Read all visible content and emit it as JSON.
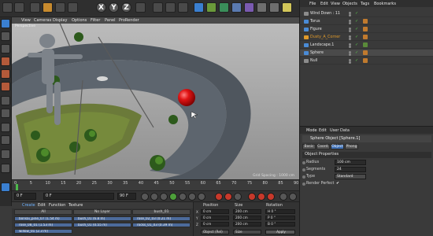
{
  "viewport": {
    "menu": [
      "View",
      "Cameras",
      "Display",
      "Options",
      "Filter",
      "Panel",
      "ProRender"
    ],
    "camera_label": "Perspective",
    "grid_spacing": "Grid Spacing : 1000 cm"
  },
  "toolbar": {
    "axis_buttons": [
      "X",
      "Y",
      "Z"
    ]
  },
  "objects": {
    "menu": [
      "File",
      "Edit",
      "View",
      "Objects",
      "Tags",
      "Bookmarks"
    ],
    "rows": [
      {
        "name": "Wind Down : 11",
        "color": "#8c8c8c"
      },
      {
        "name": "Torus",
        "color": "#4a8bd6"
      },
      {
        "name": "Figure",
        "color": "#4a8bd6"
      },
      {
        "name": "Dusty_A_Corner",
        "color": "#e09a2a"
      },
      {
        "name": "Landscape.1",
        "color": "#4a8bd6"
      },
      {
        "name": "Sphere",
        "color": "#4a8bd6"
      },
      {
        "name": "Null",
        "color": "#8c8c8c"
      }
    ]
  },
  "attributes": {
    "menu": [
      "Mode",
      "Edit",
      "User Data"
    ],
    "header": "Sphere Object [Sphere.1]",
    "tabs": [
      "Basic",
      "Coord.",
      "Object",
      "Phong"
    ],
    "active_tab": "Object",
    "section": "Object Properties",
    "fields": [
      {
        "label": "Radius",
        "value": "100 cm"
      },
      {
        "label": "Segments",
        "value": "24"
      },
      {
        "label": "Type",
        "value": "Standard"
      },
      {
        "label": "Render Perfect",
        "value": "✔"
      }
    ]
  },
  "timeline": {
    "ticks": [
      "0",
      "5",
      "10",
      "15",
      "20",
      "25",
      "30",
      "35",
      "40",
      "45",
      "50",
      "55",
      "60",
      "65",
      "70",
      "75",
      "80",
      "85",
      "90"
    ],
    "current_frame": "0 F",
    "start_frame": "0 F",
    "end_frame": "90 F",
    "max_frame": "90 F"
  },
  "materials": {
    "menu": [
      "Create",
      "Edit",
      "Function",
      "Texture"
    ],
    "active_menu": "Create",
    "columns": [
      "All",
      "No Layer",
      "bush_01"
    ],
    "items": [
      [
        "bonsai_pine_07 (1.54 m)",
        "bush_01 (6.8 m)",
        "rose_02_03 (0.21 m)"
      ],
      [
        "rose_08_01 (1.53 m)",
        "bush_01 (0.55 m)",
        "rocks_01_03 (0.39 m)"
      ],
      [
        "willow_01 (2.3 m)",
        "",
        ""
      ]
    ]
  },
  "coordinates": {
    "headers": [
      "Position",
      "Size",
      "Rotation"
    ],
    "rows": [
      {
        "axis": "X",
        "pos": "0 cm",
        "size": "200 cm",
        "rot": "H  0 °"
      },
      {
        "axis": "Y",
        "pos": "0 cm",
        "size": "200 cm",
        "rot": "P  0 °"
      },
      {
        "axis": "Z",
        "pos": "0 cm",
        "size": "200 cm",
        "rot": "B  0 °"
      }
    ],
    "mode": "Object (Rel)",
    "size_mode": "Size",
    "apply": "Apply"
  }
}
